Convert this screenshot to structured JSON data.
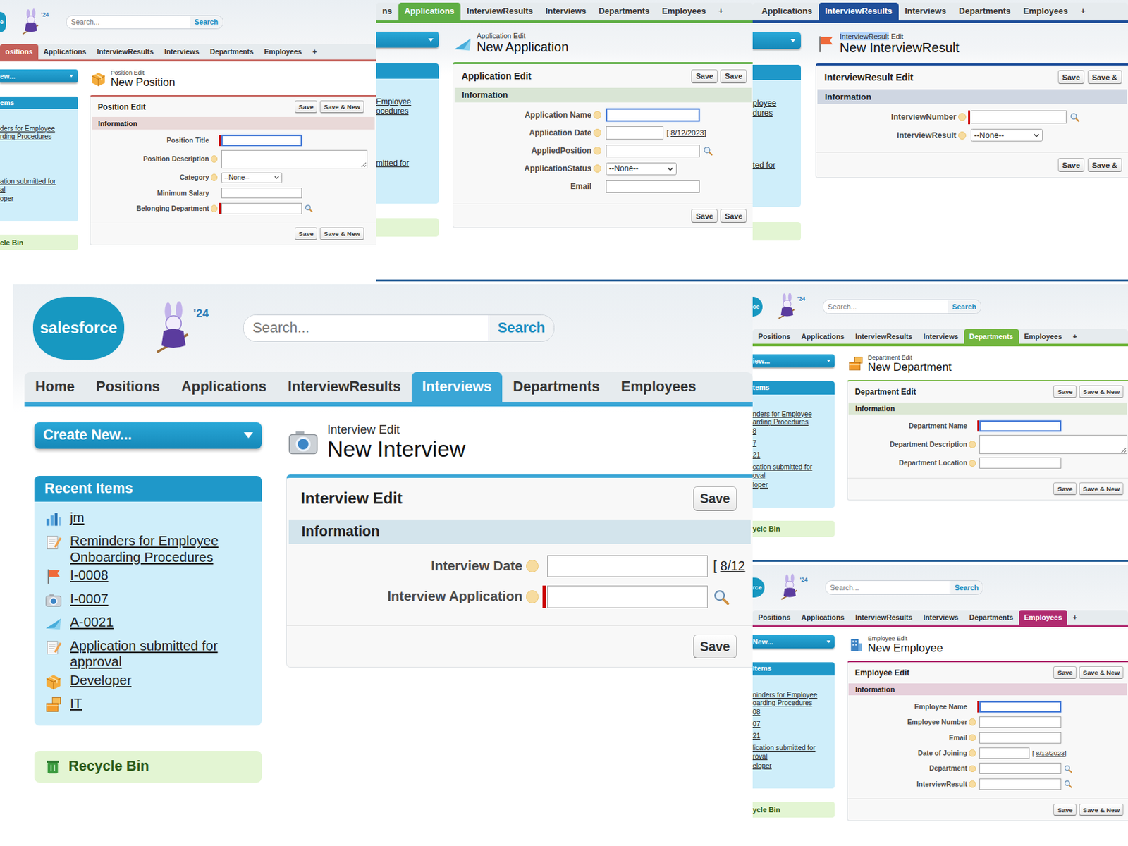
{
  "panels": [
    {
      "kind": "position",
      "color": "#c4605a",
      "header": {
        "logo": {
          "text": "e",
          "cut": true
        },
        "badge": "'24",
        "search_placeholder": "Search...",
        "search_button": "Search"
      },
      "tabs": [
        {
          "label": "ositions",
          "selected": true
        },
        {
          "label": "Applications",
          "selected": false
        },
        {
          "label": "InterviewResults",
          "selected": false
        },
        {
          "label": "Interviews",
          "selected": false
        },
        {
          "label": "Departments",
          "selected": false
        },
        {
          "label": "Employees",
          "selected": false
        },
        {
          "label": "+",
          "selected": false
        }
      ],
      "sidebar": {
        "cut": true,
        "create_new": "ew...",
        "recent_header": "ems",
        "items": [
          {
            "lines": []
          },
          {
            "lines": [
              "ders for Employee",
              "rding Procedures"
            ]
          },
          {
            "lines": []
          },
          {
            "lines": []
          },
          {
            "lines": []
          },
          {
            "lines": [
              "ation submitted for",
              "al"
            ]
          },
          {
            "lines": [
              "oper"
            ]
          },
          {
            "lines": []
          }
        ],
        "recycle_bin": "cle Bin"
      },
      "page": {
        "subtitle": [
          {
            "text": "Position Edit",
            "selected": false
          }
        ],
        "title": "New Position"
      },
      "form": {
        "title": "Position Edit",
        "buttons": [
          "Save",
          "Save & New"
        ],
        "section": "Information",
        "fields": [
          {
            "label": "Position Title",
            "kind": "text",
            "required": true,
            "focused": true,
            "help": false
          },
          {
            "label": "Position Description",
            "kind": "textarea",
            "required": false,
            "focused": false,
            "help": true
          },
          {
            "label": "Category",
            "kind": "select",
            "value": "--None--",
            "required": false,
            "focused": false,
            "help": true
          },
          {
            "label": "Minimum Salary",
            "kind": "text",
            "required": false,
            "focused": false,
            "help": false
          },
          {
            "label": "Belonging Department",
            "kind": "lookup",
            "required": true,
            "focused": false,
            "help": true
          }
        ],
        "bottom_buttons": [
          "Save",
          "Save & New"
        ]
      }
    },
    {
      "kind": "application",
      "color": "#5fae45",
      "header": null,
      "tabs": [
        {
          "label": "ns",
          "selected": false
        },
        {
          "label": "Applications",
          "selected": true
        },
        {
          "label": "InterviewResults",
          "selected": false
        },
        {
          "label": "Interviews",
          "selected": false
        },
        {
          "label": "Departments",
          "selected": false
        },
        {
          "label": "Employees",
          "selected": false
        },
        {
          "label": "+",
          "selected": false
        }
      ],
      "sidebar": {
        "cut": true,
        "create_new": "",
        "recent_header": "",
        "items": [
          {
            "lines": []
          },
          {
            "lines": [
              "Employee",
              "ocedures"
            ]
          },
          {
            "lines": []
          },
          {
            "lines": []
          },
          {
            "lines": []
          },
          {
            "lines": [
              "mitted for"
            ]
          },
          {
            "lines": []
          },
          {
            "lines": []
          }
        ],
        "recycle_bin": ""
      },
      "page": {
        "subtitle": [
          {
            "text": "Application Edit",
            "selected": false
          }
        ],
        "title": "New Application"
      },
      "form": {
        "title": "Application Edit",
        "buttons": [
          "Save",
          "Save"
        ],
        "section": "Information",
        "fields": [
          {
            "label": "Application Name",
            "kind": "text",
            "required": false,
            "focused": true,
            "help": true
          },
          {
            "label": "Application Date",
            "kind": "date",
            "required": false,
            "focused": false,
            "help": true,
            "date_hint": {
              "open": "[",
              "link": "8/12/2023",
              "close": "]"
            }
          },
          {
            "label": "AppliedPosition",
            "kind": "lookup",
            "required": false,
            "focused": false,
            "help": true
          },
          {
            "label": "ApplicationStatus",
            "kind": "select",
            "value": "--None--",
            "required": false,
            "focused": false,
            "help": true
          },
          {
            "label": "Email",
            "kind": "text",
            "required": false,
            "focused": false,
            "help": false
          }
        ],
        "bottom_buttons": [
          "Save",
          "Save"
        ]
      }
    },
    {
      "kind": "interviewresult",
      "color": "#1f4f9a",
      "header": null,
      "tabs": [
        {
          "label": "Applications",
          "selected": false
        },
        {
          "label": "InterviewResults",
          "selected": true
        },
        {
          "label": "Interviews",
          "selected": false
        },
        {
          "label": "Departments",
          "selected": false
        },
        {
          "label": "Employees",
          "selected": false
        },
        {
          "label": "+",
          "selected": false
        }
      ],
      "sidebar": {
        "cut": true,
        "create_new": "",
        "recent_header": "",
        "items": [
          {
            "lines": []
          },
          {
            "lines": [
              "ployee",
              "dures"
            ]
          },
          {
            "lines": []
          },
          {
            "lines": []
          },
          {
            "lines": []
          },
          {
            "lines": [
              "ted for"
            ]
          },
          {
            "lines": []
          },
          {
            "lines": []
          }
        ],
        "recycle_bin": ""
      },
      "page": {
        "subtitle": [
          {
            "text": "InterviewResult",
            "selected": true
          },
          {
            "text": "Edit",
            "selected": false
          }
        ],
        "title": "New InterviewResult"
      },
      "form": {
        "title": "InterviewResult Edit",
        "buttons": [
          "Save",
          "Save &"
        ],
        "section": "Information",
        "fields": [
          {
            "label": "InterviewNumber",
            "kind": "lookup",
            "required": true,
            "focused": false,
            "help": true
          },
          {
            "label": "InterviewResult",
            "kind": "select",
            "value": "--None--",
            "required": false,
            "focused": false,
            "help": true
          }
        ],
        "bottom_buttons": [
          "Save",
          "Save &"
        ]
      }
    },
    {
      "kind": "interview",
      "color": "#3aa6d6",
      "header": {
        "logo": {
          "text": "salesforce",
          "cut": false
        },
        "badge": "'24",
        "search_placeholder": "Search...",
        "search_button": "Search"
      },
      "tabs": [
        {
          "label": "Home",
          "selected": false
        },
        {
          "label": "Positions",
          "selected": false
        },
        {
          "label": "Applications",
          "selected": false
        },
        {
          "label": "InterviewResults",
          "selected": false
        },
        {
          "label": "Interviews",
          "selected": true
        },
        {
          "label": "Departments",
          "selected": false
        },
        {
          "label": "Employees",
          "selected": false
        }
      ],
      "sidebar": {
        "cut": false,
        "create_new": "Create New...",
        "recent_header": "Recent Items",
        "items": [
          {
            "lines": [
              "jm"
            ],
            "kind": "report"
          },
          {
            "lines": [
              "Reminders for Employee",
              "Onboarding Procedures"
            ],
            "kind": "article"
          },
          {
            "lines": [
              "I-0008"
            ],
            "kind": "interviewresult"
          },
          {
            "lines": [
              "I-0007"
            ],
            "kind": "interview"
          },
          {
            "lines": [
              "A-0021"
            ],
            "kind": "application"
          },
          {
            "lines": [
              "Application submitted for",
              "approval"
            ],
            "kind": "article"
          },
          {
            "lines": [
              "Developer"
            ],
            "kind": "position"
          },
          {
            "lines": [
              "IT"
            ],
            "kind": "department"
          }
        ],
        "recycle_bin": "Recycle Bin"
      },
      "page": {
        "subtitle": [
          {
            "text": "Interview Edit",
            "selected": false
          }
        ],
        "title": "New Interview"
      },
      "form": {
        "title": "Interview Edit",
        "buttons": [
          "Save"
        ],
        "section": "Information",
        "fields": [
          {
            "label": "Interview Date",
            "kind": "date",
            "required": false,
            "focused": false,
            "help": true,
            "date_hint": {
              "open": "[",
              "link": "8/12",
              "close": ""
            }
          },
          {
            "label": "Interview Application",
            "kind": "lookup",
            "required": true,
            "focused": false,
            "help": true
          }
        ],
        "bottom_buttons": [
          "Save"
        ]
      }
    },
    {
      "kind": "department",
      "color": "#73b63f",
      "header": {
        "logo": {
          "text": "ce",
          "cut": true
        },
        "badge": "'24",
        "search_placeholder": "Search...",
        "search_button": "Search"
      },
      "tabs": [
        {
          "label": "Positions",
          "selected": false
        },
        {
          "label": "Applications",
          "selected": false
        },
        {
          "label": "InterviewResults",
          "selected": false
        },
        {
          "label": "Interviews",
          "selected": false
        },
        {
          "label": "Departments",
          "selected": true
        },
        {
          "label": "Employees",
          "selected": false
        },
        {
          "label": "+",
          "selected": false
        }
      ],
      "sidebar": {
        "cut": true,
        "create_new": "iew...",
        "recent_header": "tems",
        "items": [
          {
            "lines": []
          },
          {
            "lines": [
              "nders for Employee",
              "arding Procedures"
            ]
          },
          {
            "lines": [
              "8"
            ]
          },
          {
            "lines": [
              "7"
            ]
          },
          {
            "lines": [
              "21"
            ]
          },
          {
            "lines": [
              "cation submitted for",
              "oval"
            ]
          },
          {
            "lines": [
              "loper"
            ]
          },
          {
            "lines": []
          }
        ],
        "recycle_bin": "ycle Bin"
      },
      "page": {
        "subtitle": [
          {
            "text": "Department Edit",
            "selected": false
          }
        ],
        "title": "New Department"
      },
      "form": {
        "title": "Department Edit",
        "buttons": [
          "Save",
          "Save & New"
        ],
        "section": "Information",
        "fields": [
          {
            "label": "Department Name",
            "kind": "text",
            "required": true,
            "focused": true,
            "help": false
          },
          {
            "label": "Department Description",
            "kind": "textarea",
            "required": false,
            "focused": false,
            "help": true
          },
          {
            "label": "Department Location",
            "kind": "text",
            "required": false,
            "focused": false,
            "help": true
          }
        ],
        "bottom_buttons": [
          "Save",
          "Save & New"
        ]
      }
    },
    {
      "kind": "employee",
      "color": "#b02a6f",
      "header": {
        "logo": {
          "text": "rce",
          "cut": true
        },
        "badge": "'24",
        "search_placeholder": "Search...",
        "search_button": "Search"
      },
      "tabs": [
        {
          "label": "Positions",
          "selected": false
        },
        {
          "label": "Applications",
          "selected": false
        },
        {
          "label": "InterviewResults",
          "selected": false
        },
        {
          "label": "Interviews",
          "selected": false
        },
        {
          "label": "Departments",
          "selected": false
        },
        {
          "label": "Employees",
          "selected": true
        },
        {
          "label": "+",
          "selected": false
        }
      ],
      "sidebar": {
        "cut": true,
        "create_new": "New...",
        "recent_header": "Items",
        "items": [
          {
            "lines": []
          },
          {
            "lines": [
              "ninders for Employee",
              "oarding Procedures"
            ]
          },
          {
            "lines": [
              "08"
            ]
          },
          {
            "lines": [
              "07"
            ]
          },
          {
            "lines": [
              "21"
            ]
          },
          {
            "lines": [
              "lication submitted for",
              "roval"
            ]
          },
          {
            "lines": [
              "eloper"
            ]
          },
          {
            "lines": []
          }
        ],
        "recycle_bin": "ycle Bin"
      },
      "page": {
        "subtitle": [
          {
            "text": "Employee Edit",
            "selected": false
          }
        ],
        "title": "New Employee"
      },
      "form": {
        "title": "Employee Edit",
        "buttons": [
          "Save",
          "Save & New"
        ],
        "section": "Information",
        "fields": [
          {
            "label": "Employee Name",
            "kind": "text",
            "required": true,
            "focused": true,
            "help": false
          },
          {
            "label": "Employee Number",
            "kind": "text",
            "required": false,
            "focused": false,
            "help": true
          },
          {
            "label": "Email",
            "kind": "text",
            "required": false,
            "focused": false,
            "help": true
          },
          {
            "label": "Date of Joining",
            "kind": "date",
            "required": false,
            "focused": false,
            "help": true,
            "date_hint": {
              "open": "[",
              "link": "8/12/2023",
              "close": "]"
            }
          },
          {
            "label": "Department",
            "kind": "lookup",
            "required": false,
            "focused": false,
            "help": true
          },
          {
            "label": "InterviewResult",
            "kind": "lookup",
            "required": false,
            "focused": false,
            "help": true
          }
        ],
        "bottom_buttons": [
          "Save",
          "Save & New"
        ]
      }
    }
  ]
}
